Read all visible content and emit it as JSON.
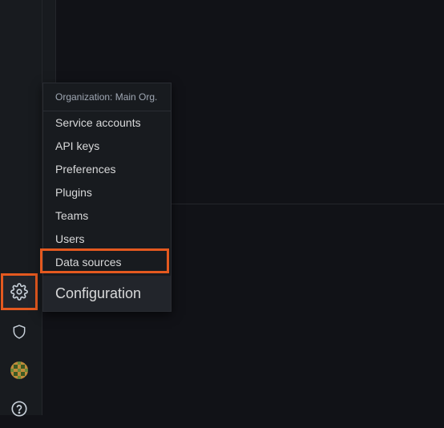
{
  "org_menu": {
    "header": "Organization: Main Org.",
    "items": [
      {
        "label": "Service accounts"
      },
      {
        "label": "API keys"
      },
      {
        "label": "Preferences"
      },
      {
        "label": "Plugins"
      },
      {
        "label": "Teams"
      },
      {
        "label": "Users"
      },
      {
        "label": "Data sources"
      }
    ],
    "footer": "Configuration"
  },
  "sidebar": {
    "icons": [
      "gear-icon",
      "shield-icon",
      "avatar",
      "help-icon"
    ]
  },
  "colors": {
    "background": "#111217",
    "panel": "#181b1f",
    "highlight": "#e4591f",
    "text": "#d8d9da"
  }
}
